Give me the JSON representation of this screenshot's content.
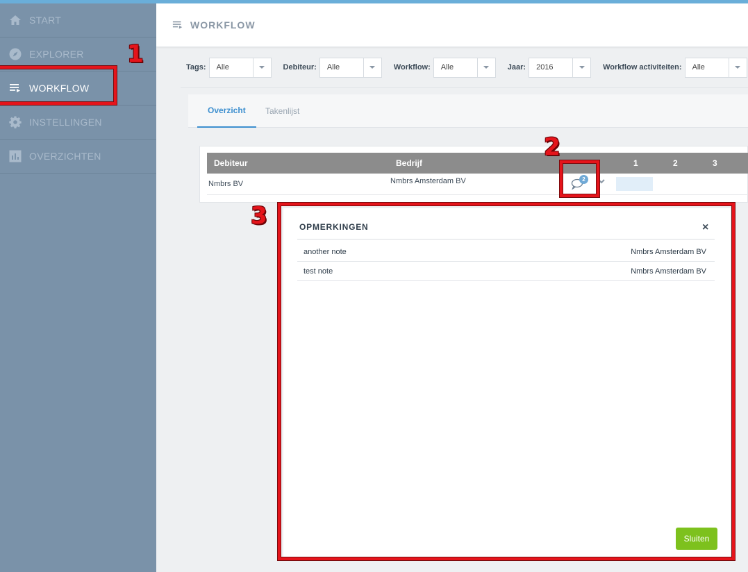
{
  "sidebar": {
    "items": [
      {
        "label": "START",
        "icon": "home-icon"
      },
      {
        "label": "EXPLORER",
        "icon": "compass-icon"
      },
      {
        "label": "WORKFLOW",
        "icon": "workflow-icon",
        "active": true
      },
      {
        "label": "INSTELLINGEN",
        "icon": "gear-icon"
      },
      {
        "label": "OVERZICHTEN",
        "icon": "bar-chart-icon"
      }
    ]
  },
  "header": {
    "title": "WORKFLOW"
  },
  "filters": {
    "tags": {
      "label": "Tags:",
      "value": "Alle"
    },
    "debiteur": {
      "label": "Debiteur:",
      "value": "Alle"
    },
    "workflow": {
      "label": "Workflow:",
      "value": "Alle"
    },
    "jaar": {
      "label": "Jaar:",
      "value": "2016"
    },
    "activiteiten": {
      "label": "Workflow activiteiten:",
      "value": "Alle"
    }
  },
  "tabs": [
    {
      "label": "Overzicht",
      "active": true
    },
    {
      "label": "Takenlijst",
      "active": false
    }
  ],
  "table": {
    "headers": {
      "debiteur": "Debiteur",
      "bedrijf": "Bedrijf",
      "c1": "1",
      "c2": "2",
      "c3": "3"
    },
    "rows": [
      {
        "debiteur": "Nmbrs BV",
        "bedrijf": "Nmbrs Amsterdam BV",
        "comment_count": "2"
      }
    ]
  },
  "annotations": {
    "n1": "1",
    "n2": "2",
    "n3": "3"
  },
  "modal": {
    "title": "OPMERKINGEN",
    "close": "×",
    "notes": [
      {
        "text": "another note",
        "company": "Nmbrs Amsterdam BV"
      },
      {
        "text": "test note",
        "company": "Nmbrs Amsterdam BV"
      }
    ],
    "button": "Sluiten"
  },
  "colors": {
    "accent": "#3d8fcf",
    "annotation": "#e5141b",
    "success": "#7dc11d",
    "sidebar": "#7a92a9"
  }
}
